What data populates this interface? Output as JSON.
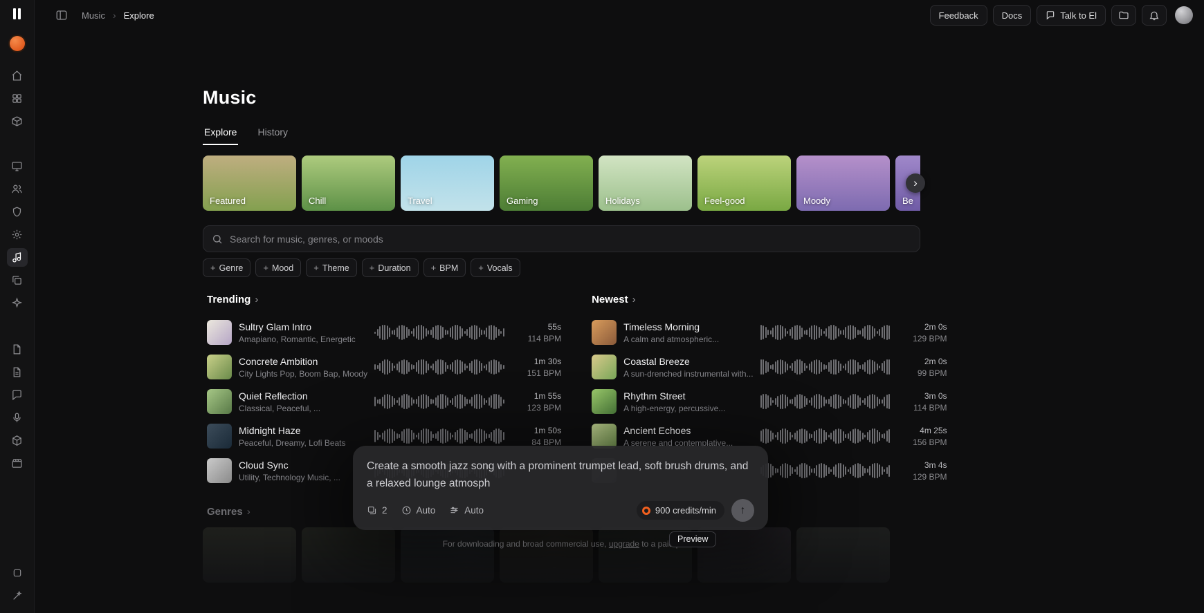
{
  "icons": {
    "plus": "+",
    "chevron_right": "›",
    "up_arrow": "↑"
  },
  "topbar": {
    "breadcrumb": {
      "parent": "Music",
      "current": "Explore"
    },
    "feedback_label": "Feedback",
    "docs_label": "Docs",
    "talk_label": "Talk to El"
  },
  "page": {
    "title": "Music",
    "tabs": [
      {
        "label": "Explore"
      },
      {
        "label": "History"
      }
    ]
  },
  "categories": [
    {
      "label": "Featured",
      "bg": "linear-gradient(180deg,#bfae80,#83a04f)"
    },
    {
      "label": "Chill",
      "bg": "linear-gradient(180deg,#aecb7e,#5d9147)"
    },
    {
      "label": "Travel",
      "bg": "linear-gradient(180deg,#9fd4e8,#c2e2ea)"
    },
    {
      "label": "Gaming",
      "bg": "linear-gradient(180deg,#82b050,#4d7d35)"
    },
    {
      "label": "Holidays",
      "bg": "linear-gradient(180deg,#d2e4c3,#9cc08c)"
    },
    {
      "label": "Feel-good",
      "bg": "linear-gradient(180deg,#bcd37b,#79a843)"
    },
    {
      "label": "Moody",
      "bg": "linear-gradient(180deg,#b590ca,#7d6bb0)"
    },
    {
      "label": "Be",
      "bg": "linear-gradient(180deg,#a088ca,#6f5ba6)"
    }
  ],
  "search": {
    "placeholder": "Search for music, genres, or moods"
  },
  "filters": [
    {
      "label": "Genre"
    },
    {
      "label": "Mood"
    },
    {
      "label": "Theme"
    },
    {
      "label": "Duration"
    },
    {
      "label": "BPM"
    },
    {
      "label": "Vocals"
    }
  ],
  "trending": {
    "title": "Trending",
    "items": [
      {
        "title": "Sultry Glam Intro",
        "subtitle": "Amapiano, Romantic, Energetic",
        "duration": "55s",
        "bpm": "114 BPM",
        "art": "linear-gradient(135deg,#ece8de,#b5a5c6)"
      },
      {
        "title": "Concrete Ambition",
        "subtitle": "City Lights Pop, Boom Bap, Moody",
        "duration": "1m 30s",
        "bpm": "151 BPM",
        "art": "linear-gradient(135deg,#c9d089,#6a8a4a)"
      },
      {
        "title": "Quiet Reflection",
        "subtitle": "Classical, Peaceful, ...",
        "duration": "1m 55s",
        "bpm": "123 BPM",
        "art": "linear-gradient(135deg,#a6c786,#587947)"
      },
      {
        "title": "Midnight Haze",
        "subtitle": "Peaceful, Dreamy, Lofi Beats",
        "duration": "1m 50s",
        "bpm": "84 BPM",
        "art": "linear-gradient(135deg,#3c4c5a,#1a2a38)"
      },
      {
        "title": "Cloud Sync",
        "subtitle": "Utility, Technology Music, ...",
        "duration": "",
        "bpm": "",
        "art": "linear-gradient(135deg,#cacaca,#8a8a8a)"
      }
    ]
  },
  "newest": {
    "title": "Newest",
    "items": [
      {
        "title": "Timeless Morning",
        "subtitle": "A calm and atmospheric...",
        "duration": "2m 0s",
        "bpm": "129 BPM",
        "art": "linear-gradient(135deg,#d99c5c,#8a5a3a)"
      },
      {
        "title": "Coastal Breeze",
        "subtitle": "A sun-drenched instrumental with...",
        "duration": "2m 0s",
        "bpm": "99 BPM",
        "art": "linear-gradient(135deg,#d9c98b,#79a759)"
      },
      {
        "title": "Rhythm Street",
        "subtitle": "A high-energy, percussive...",
        "duration": "3m 0s",
        "bpm": "114 BPM",
        "art": "linear-gradient(135deg,#9bc96b,#4a7a3a)"
      },
      {
        "title": "Ancient Echoes",
        "subtitle": "A serene and contemplative...",
        "duration": "4m 25s",
        "bpm": "156 BPM",
        "art": "linear-gradient(135deg,#b9c98b,#6a8a4a)"
      },
      {
        "title": "",
        "subtitle": "",
        "duration": "3m 4s",
        "bpm": "129 BPM",
        "art": "linear-gradient(135deg,#555558,#2a2a2d)"
      }
    ]
  },
  "genres": {
    "title": "Genres",
    "cards": [
      {
        "bg": "linear-gradient(180deg,#2b2d26,#17181a)"
      },
      {
        "bg": "linear-gradient(180deg,#292c24,#17181a)"
      },
      {
        "bg": "linear-gradient(180deg,#262a2e,#17181a)"
      },
      {
        "bg": "linear-gradient(180deg,#2d2a24,#17181a)"
      },
      {
        "bg": "linear-gradient(180deg,#272b27,#17181a)"
      },
      {
        "bg": "linear-gradient(180deg,#2a272d,#17181a)"
      },
      {
        "bg": "linear-gradient(180deg,#272927,#17181a)"
      }
    ]
  },
  "composer": {
    "prompt": "Create a smooth jazz song with a prominent trumpet lead, soft brush drums, and a relaxed lounge atmosph",
    "count": "2",
    "duration_mode": "Auto",
    "format_mode": "Auto",
    "credits": "900 credits/min"
  },
  "preview_label": "Preview",
  "footer": {
    "pre": "For downloading and broad commercial use, ",
    "link": "upgrade",
    "post": " to a paid p"
  }
}
